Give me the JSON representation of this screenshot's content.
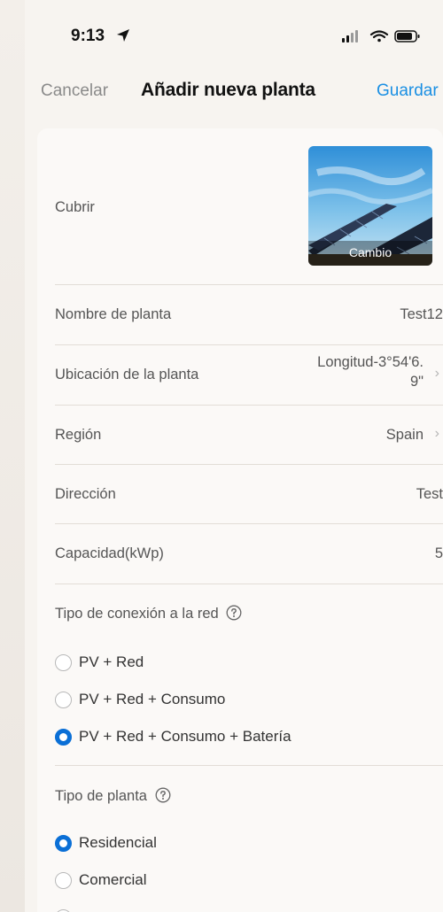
{
  "status_bar": {
    "time": "9:13"
  },
  "nav": {
    "cancel_label": "Cancelar",
    "title": "Añadir nueva planta",
    "save_label": "Guardar"
  },
  "form": {
    "cover": {
      "label": "Cubrir",
      "change_label": "Cambio"
    },
    "plant_name": {
      "label": "Nombre de planta",
      "value": "Test12"
    },
    "location": {
      "label": "Ubicación de la planta",
      "value_line1": "Longitud-3°54'6.",
      "value_line2": "9\""
    },
    "region": {
      "label": "Región",
      "value": "Spain"
    },
    "address": {
      "label": "Dirección",
      "value": "Test"
    },
    "capacity": {
      "label": "Capacidad(kWp)",
      "value": "5"
    },
    "grid_type": {
      "label": "Tipo de conexión a la red",
      "options": [
        {
          "label": "PV + Red",
          "selected": false
        },
        {
          "label": "PV + Red + Consumo",
          "selected": false
        },
        {
          "label": "PV + Red + Consumo + Batería",
          "selected": true
        }
      ]
    },
    "plant_type": {
      "label": "Tipo de planta",
      "options": [
        {
          "label": "Residencial",
          "selected": true
        },
        {
          "label": "Comercial",
          "selected": false
        }
      ]
    }
  },
  "colors": {
    "accent": "#1a8fe3",
    "radio_selected": "#0a6fd6",
    "background": "#f7f4f0"
  }
}
